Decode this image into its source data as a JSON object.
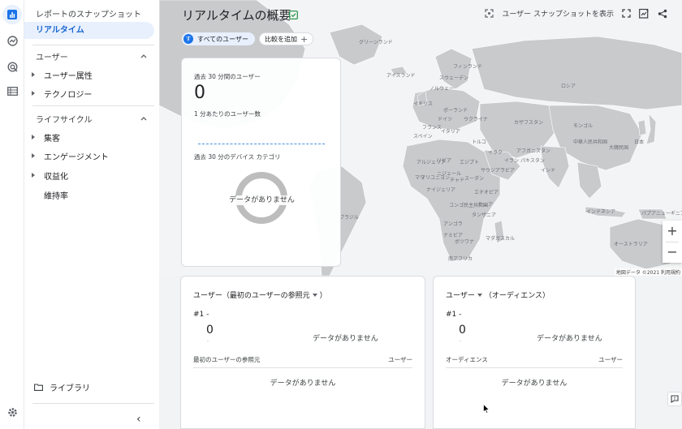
{
  "nav": {
    "report_snapshot": "レポートのスナップショット",
    "realtime": "リアルタイム",
    "users_section": "ユーザー",
    "users_items": [
      "ユーザー属性",
      "テクノロジー"
    ],
    "lifecycle_section": "ライフサイクル",
    "lifecycle_items": [
      "集客",
      "エンゲージメント",
      "収益化",
      "維持率"
    ],
    "library": "ライブラリ"
  },
  "header": {
    "title": "リアルタイムの概要",
    "show_snapshot": "ユーザー スナップショットを表示"
  },
  "comparison": {
    "chip_avatar": "す",
    "chip_label": "すべてのユーザー",
    "add_compare": "比較を追加"
  },
  "realtime_card": {
    "users_30min_label": "過去 30 分間のユーザー",
    "users_30min_value": "0",
    "per_minute_label": "1 分あたりのユーザー数",
    "device_label": "過去 30 分のデバイス カテゴリ",
    "no_data": "データがありません"
  },
  "map": {
    "labels": [
      "グリーンランド",
      "アイスランド",
      "フィンランド",
      "スウェーデン",
      "ノルウェー",
      "ロシア",
      "イギリス",
      "ドイツ",
      "ポーランド",
      "ウクライナ",
      "フランス",
      "イタリア",
      "スペイン",
      "トルコ",
      "カザフスタン",
      "モンゴル",
      "中華人民共和国",
      "日本",
      "大韓民国",
      "イラク",
      "イラン",
      "アフガニスタン",
      "パキスタン",
      "インド",
      "アルジェリア",
      "リビア",
      "エジプト",
      "サウジアラビア",
      "マリ",
      "ニジェール",
      "チャド",
      "スーダン",
      "エチオピア",
      "マリユニヨン",
      "ナイジェリア",
      "コンゴ民主共和国",
      "ケニア",
      "タンザニア",
      "アンゴラ",
      "ナミビア",
      "ボツワナ",
      "マダガスカル",
      "南アフリカ",
      "インドネシア",
      "パプアニューギニア",
      "オーストラリア",
      "ブラジル"
    ],
    "attribution": "地図データ ©2021 利用規約",
    "zoom_in": "+",
    "zoom_out": "−"
  },
  "card_source": {
    "title": "ユーザー（最初のユーザーの参照元",
    "title_end": "）",
    "rank": "#1",
    "rank_dash": "-",
    "value": "0",
    "value_sub": "-",
    "no_data": "データがありません",
    "col1": "最初のユーザーの参照元",
    "col2": "ユーザー",
    "table_no_data": "データがありません"
  },
  "card_audience": {
    "title": "ユーザー",
    "title_end": "（オーディエンス）",
    "rank": "#1",
    "rank_dash": "-",
    "value": "0",
    "value_sub": "-",
    "no_data": "データがありません",
    "col1": "オーディエンス",
    "col2": "ユーザー",
    "table_no_data": "データがありません"
  },
  "colors": {
    "accent": "#1a73e8",
    "active_bg": "#e8f0fe",
    "land": "#c8cacc",
    "sea": "#f3f4f5"
  }
}
